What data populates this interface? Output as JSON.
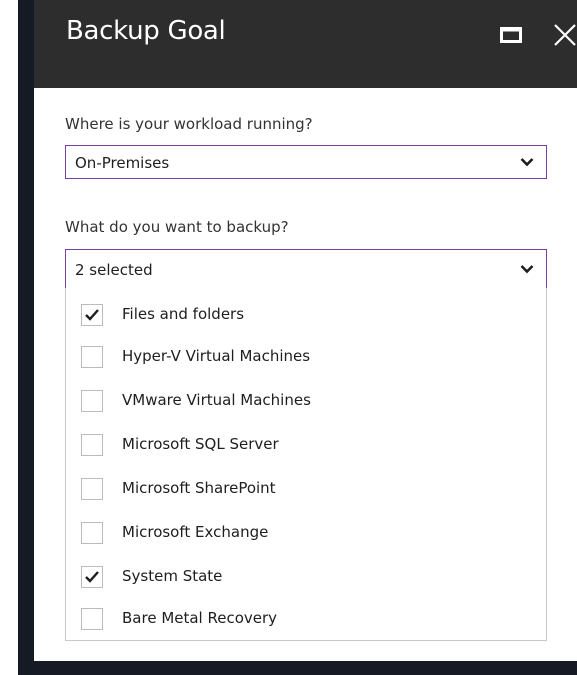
{
  "window": {
    "title": "Backup Goal"
  },
  "workload": {
    "label": "Where is your workload running?",
    "selected": "On-Premises"
  },
  "backup": {
    "label": "What do you want to backup?",
    "selected_summary": "2 selected",
    "options": [
      {
        "label": "Files and folders",
        "checked": true
      },
      {
        "label": "Hyper-V Virtual Machines",
        "checked": false
      },
      {
        "label": "VMware Virtual Machines",
        "checked": false
      },
      {
        "label": "Microsoft SQL Server",
        "checked": false
      },
      {
        "label": "Microsoft SharePoint",
        "checked": false
      },
      {
        "label": "Microsoft Exchange",
        "checked": false
      },
      {
        "label": "System State",
        "checked": true
      },
      {
        "label": "Bare Metal Recovery",
        "checked": false
      }
    ]
  },
  "icons": {
    "maximize": "maximize-icon",
    "close": "close-icon",
    "chevron": "chevron-down-icon",
    "check": "checkmark-icon"
  },
  "colors": {
    "header_bg": "#2d2d2d",
    "frame": "#161a24",
    "focus_border": "#7a3fa6"
  }
}
